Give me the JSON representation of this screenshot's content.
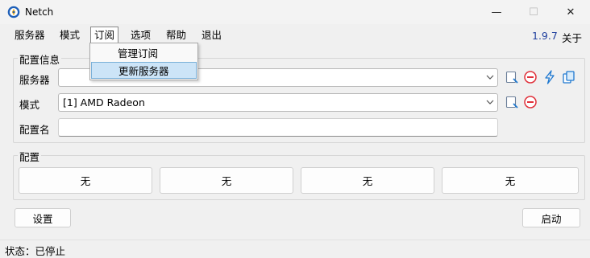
{
  "window": {
    "title": "Netch",
    "controls": {
      "minimize": "—",
      "maximize": "☐",
      "close": "✕"
    }
  },
  "menu": {
    "items": [
      "服务器",
      "模式",
      "订阅",
      "选项",
      "帮助",
      "退出"
    ],
    "version": "1.9.7",
    "about": "关于"
  },
  "subscribe_menu": {
    "items": [
      "管理订阅",
      "更新服务器"
    ],
    "highlighted": "更新服务器"
  },
  "config_info": {
    "group_label": "配置信息",
    "server_label": "服务器",
    "server_value": "",
    "mode_label": "模式",
    "mode_value": "[1] AMD Radeon",
    "profile_name_label": "配置名",
    "profile_name_value": ""
  },
  "profiles": {
    "group_label": "配置",
    "buttons": [
      "无",
      "无",
      "无",
      "无"
    ]
  },
  "actions": {
    "settings": "设置",
    "start": "启动"
  },
  "status": {
    "text": "状态：已停止"
  },
  "colors": {
    "accent": "#1e78d0",
    "version": "#1f3f9e",
    "delete": "#e0303a",
    "highlight": "#cce4f7"
  }
}
